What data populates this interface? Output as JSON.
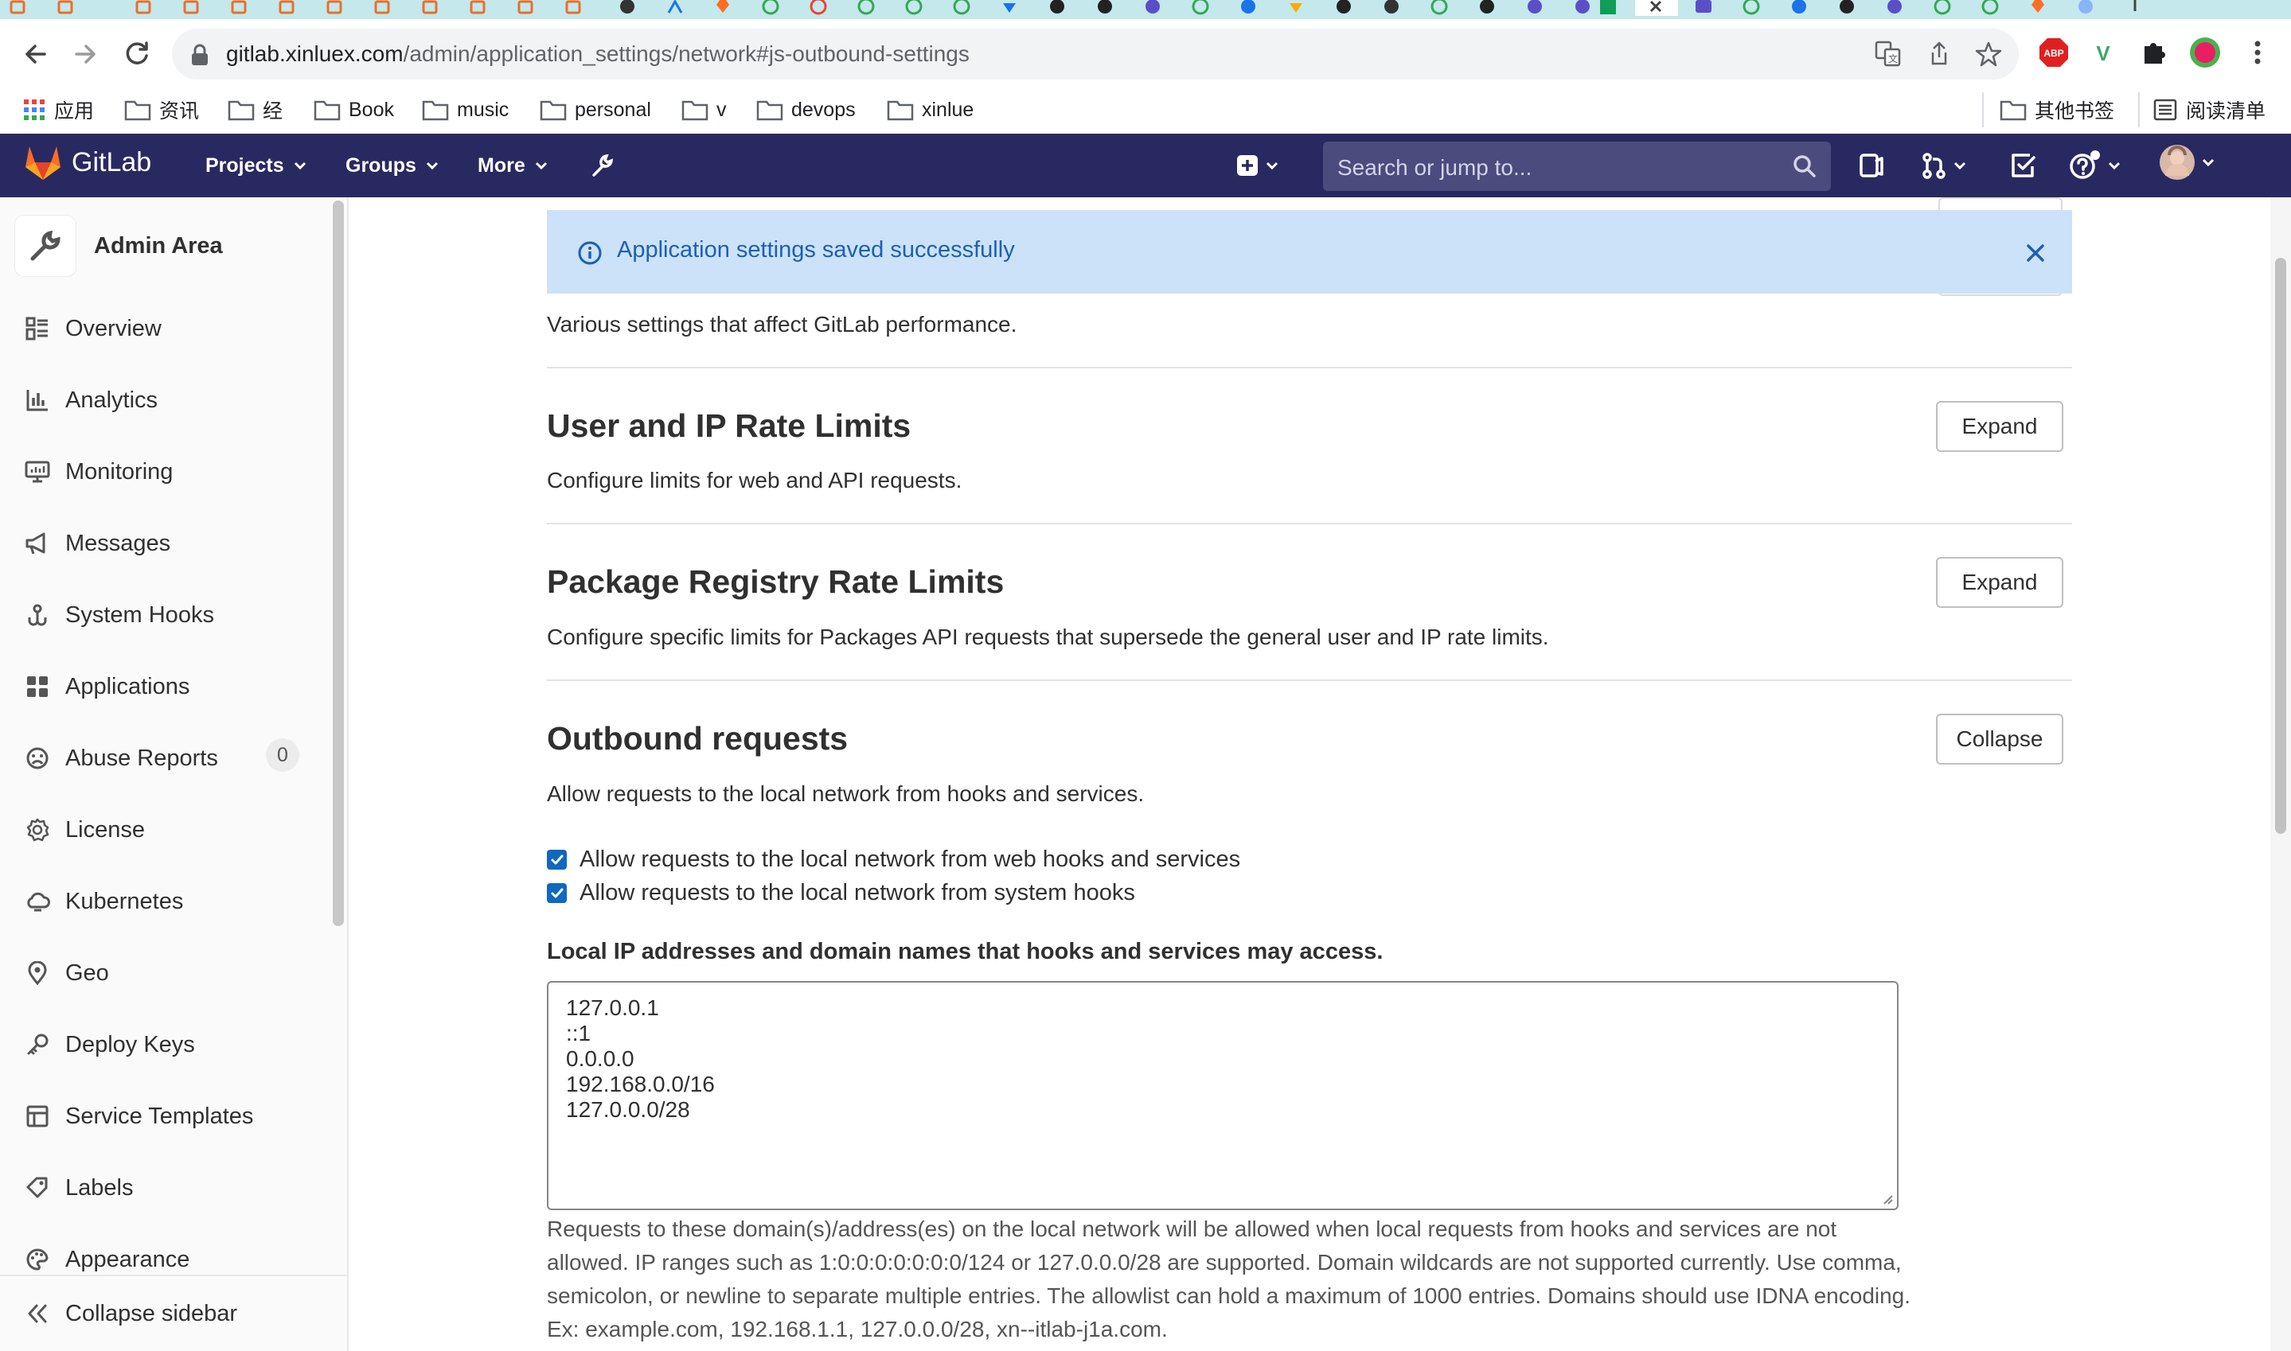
{
  "browser": {
    "url_host": "gitlab.xinluex.com",
    "url_path": "/admin/application_settings/network#js-outbound-settings",
    "bookmarks": [
      {
        "label": "应用",
        "icon": "apps-grid-icon"
      },
      {
        "label": "资讯",
        "icon": "folder-icon"
      },
      {
        "label": "经",
        "icon": "folder-icon"
      },
      {
        "label": "Book",
        "icon": "folder-icon"
      },
      {
        "label": "music",
        "icon": "folder-icon"
      },
      {
        "label": "personal",
        "icon": "folder-icon"
      },
      {
        "label": "v",
        "icon": "folder-icon"
      },
      {
        "label": "devops",
        "icon": "folder-icon"
      },
      {
        "label": "xinlue",
        "icon": "folder-icon"
      }
    ],
    "other_bookmarks": "其他书签",
    "reading_list": "阅读清单",
    "extension_abp": "ABP",
    "extension_v": "V"
  },
  "topnav": {
    "brand": "GitLab",
    "projects": "Projects",
    "groups": "Groups",
    "more": "More",
    "search_placeholder": "Search or jump to..."
  },
  "sidebar": {
    "title": "Admin Area",
    "items": [
      {
        "label": "Overview",
        "icon": "overview-icon"
      },
      {
        "label": "Analytics",
        "icon": "analytics-icon"
      },
      {
        "label": "Monitoring",
        "icon": "monitor-icon"
      },
      {
        "label": "Messages",
        "icon": "megaphone-icon"
      },
      {
        "label": "System Hooks",
        "icon": "hook-icon"
      },
      {
        "label": "Applications",
        "icon": "applications-icon"
      },
      {
        "label": "Abuse Reports",
        "icon": "abuse-icon"
      },
      {
        "label": "License",
        "icon": "license-icon"
      },
      {
        "label": "Kubernetes",
        "icon": "kubernetes-icon"
      },
      {
        "label": "Geo",
        "icon": "location-pin-icon"
      },
      {
        "label": "Deploy Keys",
        "icon": "key-icon"
      },
      {
        "label": "Service Templates",
        "icon": "template-icon"
      },
      {
        "label": "Labels",
        "icon": "label-icon"
      },
      {
        "label": "Appearance",
        "icon": "palette-icon"
      }
    ],
    "abuse_reports_count": "0",
    "collapse_label": "Collapse sidebar"
  },
  "main": {
    "flash_message": "Application settings saved successfully",
    "performance_desc": "Various settings that affect GitLab performance.",
    "sections": [
      {
        "title": "User and IP Rate Limits",
        "description": "Configure limits for web and API requests.",
        "button": "Expand"
      },
      {
        "title": "Package Registry Rate Limits",
        "description": "Configure specific limits for Packages API requests that supersede the general user and IP rate limits.",
        "button": "Expand"
      },
      {
        "title": "Outbound requests",
        "description": "Allow requests to the local network from hooks and services.",
        "button": "Collapse"
      }
    ],
    "checkboxes": [
      {
        "label": "Allow requests to the local network from web hooks and services",
        "checked": true
      },
      {
        "label": "Allow requests to the local network from system hooks",
        "checked": true
      }
    ],
    "allowlist_label": "Local IP addresses and domain names that hooks and services may access.",
    "allowlist_lines": [
      "127.0.0.1",
      "::1",
      "0.0.0.0",
      "192.168.0.0/16",
      "127.0.0.0/28"
    ],
    "help_text": "Requests to these domain(s)/address(es) on the local network will be allowed when local requests from hooks and services are not allowed. IP ranges such as 1:0:0:0:0:0:0:0/124 or 127.0.0.0/28 are supported. Domain wildcards are not supported currently. Use comma, semicolon, or newline to separate multiple entries. The allowlist can hold a maximum of 1000 entries. Domains should use IDNA encoding. Ex: example.com, 192.168.1.1, 127.0.0.0/28, xn--itlab-j1a.com."
  },
  "colors": {
    "nav_bg": "#292961",
    "accent_blue": "#1068bf",
    "flash_bg": "#cbe2f9",
    "tab_strip": "#c4e8ec"
  }
}
